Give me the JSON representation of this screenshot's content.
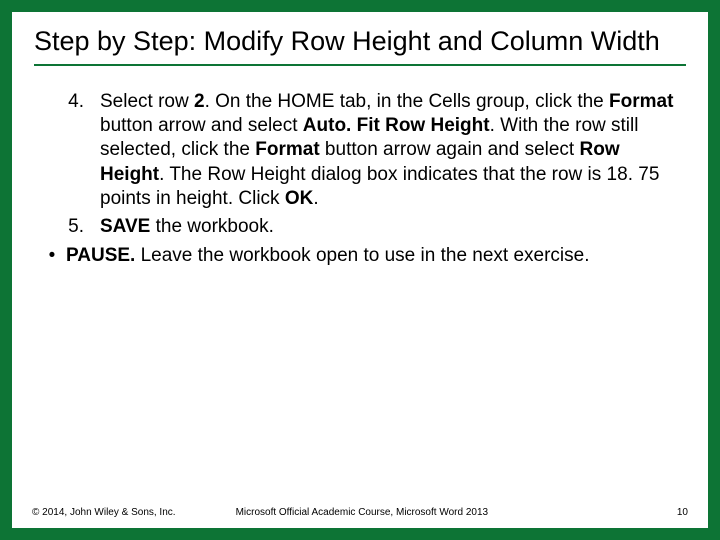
{
  "title": "Step by Step: Modify Row Height and Column Width",
  "items": {
    "step4": {
      "num": "4.",
      "t1": "Select row ",
      "b1": "2",
      "t2": ". On the HOME tab, in the Cells group, click the ",
      "b2": "Format",
      "t3": " button arrow and select ",
      "b3": "Auto. Fit Row Height",
      "t4": ". With the row still selected, click the ",
      "b4": "Format",
      "t5": " button arrow again and select ",
      "b5": "Row Height",
      "t6": ". The Row Height dialog box indicates that the row is 18. 75 points in height. Click ",
      "b6": "OK",
      "t7": "."
    },
    "step5": {
      "num": "5.",
      "b1": "SAVE ",
      "t1": "the workbook."
    },
    "pause": {
      "bullet": "•",
      "b1": "PAUSE. ",
      "t1": "Leave the workbook open to use in the next exercise."
    }
  },
  "footer": {
    "copyright": "© 2014, John Wiley & Sons, Inc.",
    "course": "Microsoft Official Academic Course, Microsoft Word 2013",
    "page": "10"
  }
}
